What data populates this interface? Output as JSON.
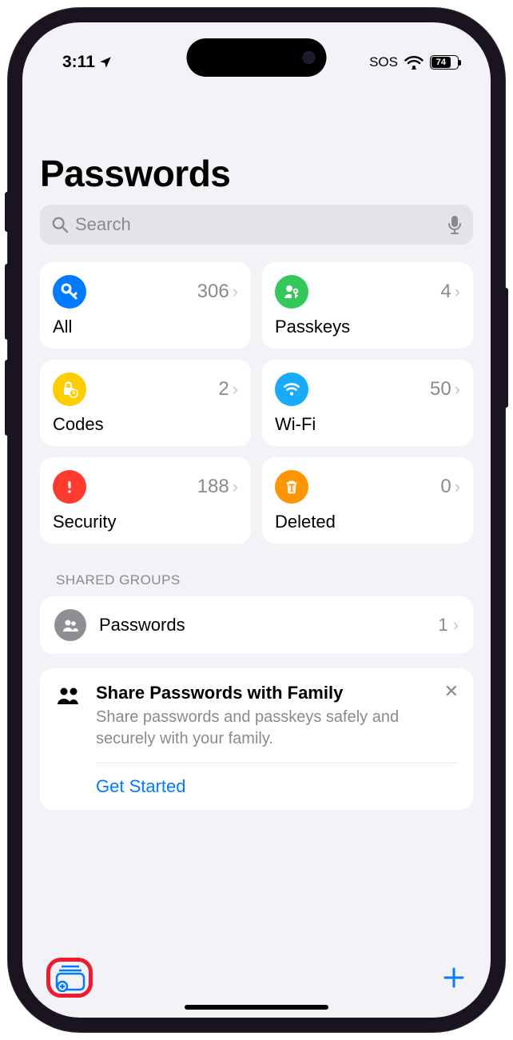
{
  "status": {
    "time": "3:11",
    "sos": "SOS",
    "battery_pct": "74",
    "battery_width": "74%"
  },
  "header": {
    "title": "Passwords"
  },
  "search": {
    "placeholder": "Search"
  },
  "tiles": {
    "all": {
      "label": "All",
      "count": "306"
    },
    "passkeys": {
      "label": "Passkeys",
      "count": "4"
    },
    "codes": {
      "label": "Codes",
      "count": "2"
    },
    "wifi": {
      "label": "Wi-Fi",
      "count": "50"
    },
    "security": {
      "label": "Security",
      "count": "188"
    },
    "deleted": {
      "label": "Deleted",
      "count": "0"
    }
  },
  "colors": {
    "all": "#007aff",
    "passkeys": "#34c759",
    "codes": "#ffcc00",
    "wifi": "#19aaf8",
    "security": "#ff3b30",
    "deleted": "#ff9500",
    "group_icon": "#8e8e93"
  },
  "shared": {
    "header": "SHARED GROUPS",
    "row": {
      "label": "Passwords",
      "count": "1"
    }
  },
  "promo": {
    "title": "Share Passwords with Family",
    "desc": "Share passwords and passkeys safely and securely with your family.",
    "action": "Get Started"
  }
}
